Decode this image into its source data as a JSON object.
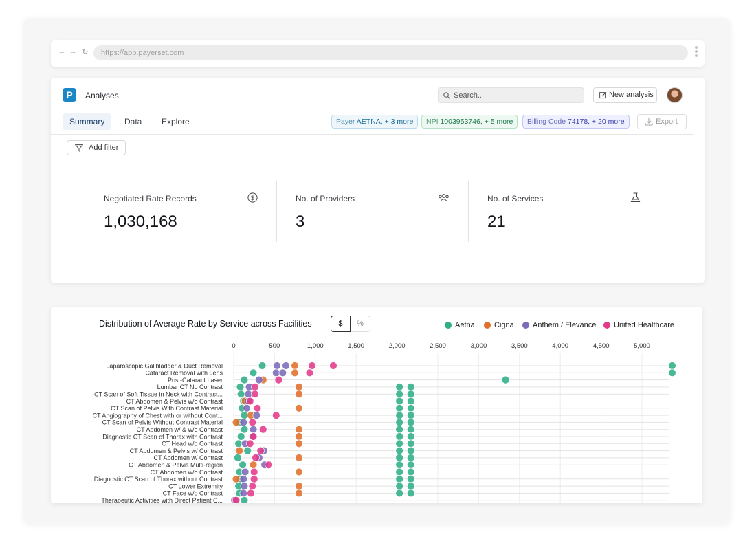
{
  "browser": {
    "back_icon": "arrow-left-icon",
    "forward_icon": "arrow-right-icon",
    "reload_icon": "reload-icon",
    "url": "https://app.payerset.com"
  },
  "header": {
    "logo_letter": "P",
    "title": "Analyses",
    "search_placeholder": "Search...",
    "new_analysis_label": "New analysis"
  },
  "tabs": [
    {
      "label": "Summary",
      "active": true
    },
    {
      "label": "Data",
      "active": false
    },
    {
      "label": "Explore",
      "active": false
    }
  ],
  "chips": {
    "payer": {
      "key": "Payer",
      "value": "AETNA, + 3 more"
    },
    "npi": {
      "key": "NPI",
      "value": "1003953746, + 5 more"
    },
    "billing": {
      "key": "Billing Code",
      "value": "74178, + 20 more"
    }
  },
  "export_label": "Export",
  "filter_label": "Add filter",
  "stats": [
    {
      "label": "Negotiated Rate Records",
      "value": "1,030,168",
      "icon": "dollar-circle-icon"
    },
    {
      "label": "No. of Providers",
      "value": "3",
      "icon": "users-icon"
    },
    {
      "label": "No. of Services",
      "value": "21",
      "icon": "flask-icon"
    }
  ],
  "chart_toggle": {
    "dollar": "$",
    "percent": "%"
  },
  "colors": {
    "Aetna": "#2fae87",
    "Cigna": "#e0702a",
    "Anthem / Elevance": "#7b6bb8",
    "United Healthcare": "#e23b8a"
  },
  "chart_data": {
    "type": "scatter",
    "title": "Distribution of Average Rate by Service across Facilities",
    "legend": [
      "Aetna",
      "Cigna",
      "Anthem / Elevance",
      "United Healthcare"
    ],
    "legend_position": "top-right",
    "xlim": [
      0,
      5300
    ],
    "x_ticks": [
      0,
      500,
      1000,
      1500,
      2000,
      2500,
      3000,
      3500,
      4000,
      4500,
      5000
    ],
    "x_tick_labels": [
      "0",
      "500",
      "1,000",
      "1,500",
      "2,000",
      "2,500",
      "3,000",
      "3,500",
      "4,000",
      "4,500",
      "5,000"
    ],
    "grid": true,
    "categories": [
      "Laparoscopic Gallbladder & Duct Removal",
      "Cataract Removal with Lens",
      "Post-Cataract Laser",
      "Lumbar CT No Contrast",
      "CT Scan of Soft Tissue in Neck with Contrast...",
      "CT Abdomen & Pelvis w/o Contrast",
      "CT Scan of Pelvis With Contrast Material",
      "CT Angiography of Chest with or without Cont...",
      "CT Scan of Pelvis Without Contrast Material",
      "CT Abdomen w/ & w/o Contrast",
      "Diagnostic CT Scan of Thorax with Contrast",
      "CT Head w/o Contrast",
      "CT Abdomen & Pelvis w/ Contrast",
      "CT Abdomen w/ Contrast",
      "CT Abdomen & Pelvis Multi-region",
      "CT Abdomen w/o Contrast",
      "Diagnostic CT Scan of Thorax without Contrast",
      "CT Lower Extremity",
      "CT Face w/o Contrast",
      "Therapeutic Activities with Direct Patient C..."
    ],
    "series": [
      {
        "name": "Aetna",
        "values": [
          [
            350,
            5370
          ],
          [
            240,
            5370
          ],
          [
            130,
            3330
          ],
          [
            80,
            2030,
            2170
          ],
          [
            90,
            2030,
            2170
          ],
          [
            120,
            2030,
            2170
          ],
          [
            100,
            2030,
            2170
          ],
          [
            130,
            2030,
            2170
          ],
          [
            70,
            2030,
            2170
          ],
          [
            130,
            2030,
            2170
          ],
          [
            90,
            2030,
            2170
          ],
          [
            60,
            2030,
            2170
          ],
          [
            170,
            2030,
            2170
          ],
          [
            50,
            2030,
            2170
          ],
          [
            110,
            2030,
            2170
          ],
          [
            70,
            2030,
            2170
          ],
          [
            80,
            2030,
            2170
          ],
          [
            60,
            2030,
            2170
          ],
          [
            70,
            2030,
            2170
          ],
          [
            20,
            130
          ]
        ]
      },
      {
        "name": "Cigna",
        "values": [
          [
            750
          ],
          [
            750
          ],
          [
            360
          ],
          [
            800
          ],
          [
            800
          ],
          [
            140
          ],
          [
            800
          ],
          [
            210
          ],
          [
            30
          ],
          [
            800
          ],
          [
            800
          ],
          [
            800
          ],
          [
            70
          ],
          [
            800
          ],
          [
            240
          ],
          [
            800
          ],
          [
            30
          ],
          [
            800
          ],
          [
            800
          ],
          [
            20
          ]
        ]
      },
      {
        "name": "Anthem / Elevance",
        "values": [
          [
            530,
            640
          ],
          [
            520,
            600
          ],
          [
            310
          ],
          [
            190
          ],
          [
            180
          ],
          [
            180
          ],
          [
            160
          ],
          [
            280
          ],
          [
            120
          ],
          [
            240
          ],
          [
            240
          ],
          [
            140
          ],
          [
            370
          ],
          [
            310
          ],
          [
            380
          ],
          [
            140
          ],
          [
            120
          ],
          [
            130
          ],
          [
            120
          ],
          [
            10
          ]
        ]
      },
      {
        "name": "United Healthcare",
        "values": [
          [
            960,
            1220
          ],
          [
            930
          ],
          [
            550
          ],
          [
            260
          ],
          [
            260
          ],
          [
            200
          ],
          [
            290
          ],
          [
            520
          ],
          [
            230
          ],
          [
            360
          ],
          [
            240
          ],
          [
            200
          ],
          [
            330
          ],
          [
            270
          ],
          [
            430
          ],
          [
            250
          ],
          [
            250
          ],
          [
            230
          ],
          [
            210
          ],
          [
            30
          ]
        ]
      }
    ]
  }
}
